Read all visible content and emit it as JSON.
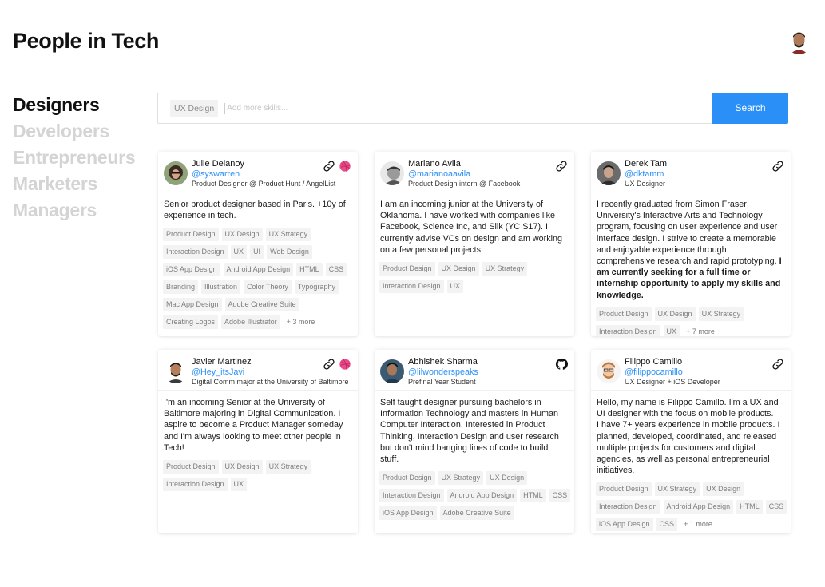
{
  "app": {
    "title": "People in Tech"
  },
  "nav": [
    "Designers",
    "Developers",
    "Entrepreneurs",
    "Marketers",
    "Managers"
  ],
  "search": {
    "selected": "UX Design",
    "placeholder": "Add more skills...",
    "button": "Search"
  },
  "colors": {
    "accent": "#2b8ff8",
    "dribbble": "#ea4c89"
  },
  "cards": [
    {
      "name": "Julie Delanoy",
      "handle": "@syswarren",
      "role": "Product Designer @ Product Hunt / AngelList",
      "icons": [
        "link-icon",
        "dribbble-icon"
      ],
      "bio": "Senior product designer based in Paris. +10y of experience in tech.",
      "tags": [
        "Product Design",
        "UX Design",
        "UX Strategy",
        "Interaction Design",
        "UX",
        "UI",
        "Web Design",
        "iOS App Design",
        "Android App Design",
        "HTML",
        "CSS",
        "Branding",
        "Illustration",
        "Color Theory",
        "Typography",
        "Mac App Design",
        "Adobe Creative Suite",
        "Creating Logos",
        "Adobe Illustrator"
      ],
      "more": "+ 3 more"
    },
    {
      "name": "Mariano Avila",
      "handle": "@marianoaavila",
      "role": "Product Design intern @ Facebook",
      "icons": [
        "link-icon"
      ],
      "bio": "I am an incoming junior at the University of Oklahoma. I have worked with companies like Facebook, Science Inc, and Slik (YC S17). I currently advise VCs on design and am working on a few personal projects.",
      "tags": [
        "Product Design",
        "UX Design",
        "UX Strategy",
        "Interaction Design",
        "UX"
      ],
      "more": ""
    },
    {
      "name": "Derek Tam",
      "handle": "@dktamm",
      "role": "UX Designer",
      "icons": [
        "link-icon"
      ],
      "bio": "I recently graduated from Simon Fraser University's Interactive Arts and Technology program, focusing on user experience and user interface design. I strive to create a memorable and enjoyable experience through comprehensive research and rapid prototyping.",
      "bio_bold": "I am currently seeking for a full time or internship opportunity to apply my skills and knowledge.",
      "tags": [
        "Product Design",
        "UX Design",
        "UX Strategy",
        "Interaction Design",
        "UX"
      ],
      "more": "+ 7 more"
    },
    {
      "name": "Javier Martinez",
      "handle": "@Hey_itsJavi",
      "role": "Digital Comm major at the University of Baltimore",
      "icons": [
        "link-icon",
        "dribbble-icon"
      ],
      "bio": "I'm an incoming Senior at the University of Baltimore majoring in Digital Communication. I aspire to become a Product Manager someday and I'm always looking to meet other people in Tech!",
      "tags": [
        "Product Design",
        "UX Design",
        "UX Strategy",
        "Interaction Design",
        "UX"
      ],
      "more": ""
    },
    {
      "name": "Abhishek Sharma",
      "handle": "@lilwonderspeaks",
      "role": "Prefinal Year Student",
      "icons": [
        "github-icon"
      ],
      "bio": "Self taught designer pursuing bachelors in Information Technology and masters in Human Computer Interaction. Interested in Product Thinking, Interaction Design and user research but don't mind banging lines of code to build stuff.",
      "tags": [
        "Product Design",
        "UX Strategy",
        "UX Design",
        "Interaction Design",
        "Android App Design",
        "HTML",
        "CSS",
        "iOS App Design",
        "Adobe Creative Suite"
      ],
      "more": ""
    },
    {
      "name": "Filippo Camillo",
      "handle": "@filippocamillo",
      "role": "UX Designer + iOS Developer",
      "icons": [
        "link-icon"
      ],
      "bio": "Hello, my name is Filippo Camillo. I'm a UX and UI designer with the focus on mobile products.\nI have 7+ years experience in mobile products. I planned, developed, coordinated, and released multiple projects for customers and digital agencies, as well as personal entrepreneurial initiatives.",
      "tags": [
        "Product Design",
        "UX Strategy",
        "UX Design",
        "Interaction Design",
        "Android App Design",
        "HTML",
        "CSS",
        "iOS App Design",
        "CSS"
      ],
      "more": "+ 1 more"
    }
  ]
}
